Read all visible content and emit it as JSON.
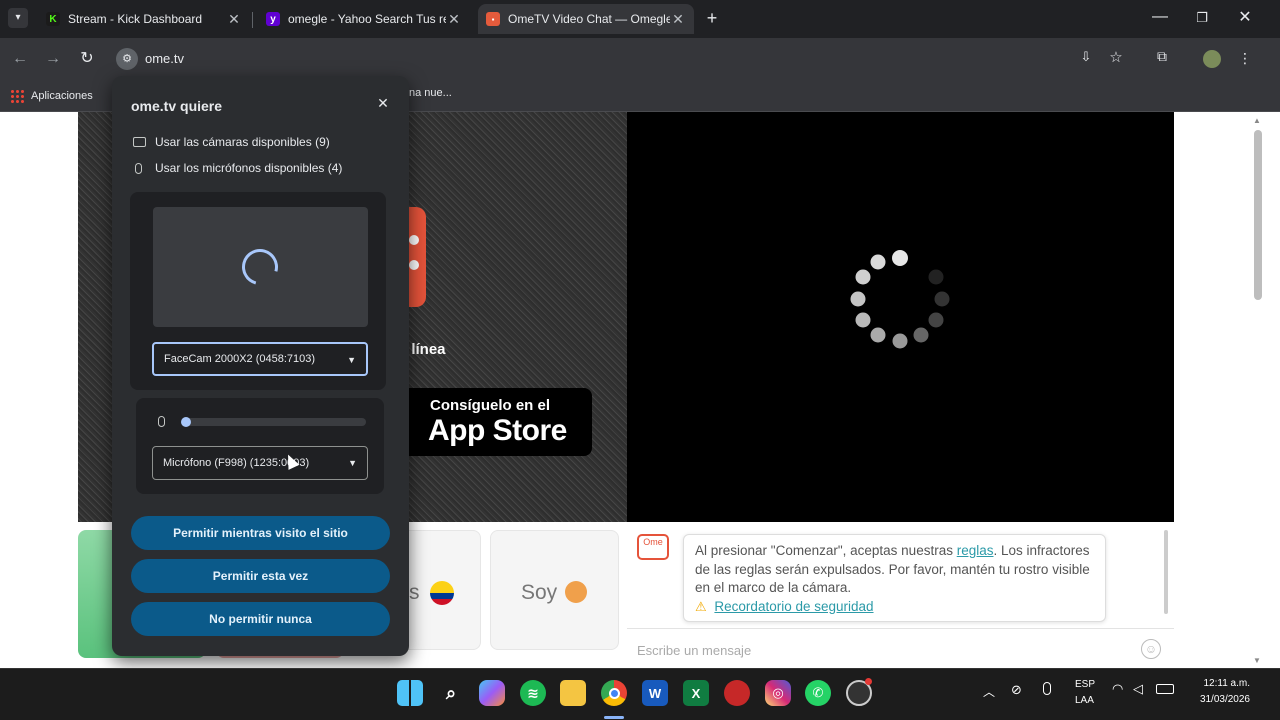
{
  "tabs": [
    {
      "title": "Stream - Kick Dashboard",
      "active": false
    },
    {
      "title": "omegle - Yahoo Search Tus resu",
      "active": false
    },
    {
      "title": "OmeTV Video Chat — Omegle",
      "active": true
    }
  ],
  "address": {
    "url": "ome.tv"
  },
  "bookmarks": {
    "apps_label": "Aplicaciones",
    "partial_item": "na nue..."
  },
  "permission_popup": {
    "title": "ome.tv quiere",
    "camera_request": "Usar las cámaras disponibles (9)",
    "mic_request": "Usar los micrófonos disponibles (4)",
    "camera_select": "FaceCam 2000X2 (0458:7103)",
    "mic_select": "Micrófono (F998) (1235:0003)",
    "mic_level": 0.0,
    "buttons": {
      "allow_while_visiting": "Permitir mientras visito el sitio",
      "allow_once": "Permitir esta vez",
      "never_allow": "No permitir nunca"
    }
  },
  "page": {
    "online_text_partial": "n línea",
    "app_store": {
      "line1": "Consíguelo en el",
      "line2": "App Store"
    },
    "soy_text": "Soy",
    "flag_partial_text": "s",
    "chat_notice": {
      "text_before": "Al presionar \"Comenzar\", aceptas nuestras ",
      "link": "reglas",
      "text_after": ". Los infractores de las reglas serán expulsados. Por favor, mantén tu rostro visible en el marco de la cámara.",
      "safety_link": "Recordatorio de seguridad"
    },
    "message_placeholder": "Escribe un mensaje",
    "logo_text": "Ome"
  },
  "taskbar": {
    "lang_top": "ESP",
    "lang_bottom": "LAA",
    "time": "12:11 a.m.",
    "date": "31/03/2026"
  },
  "colors": {
    "permit_button": "#0b5a8a",
    "chrome_dark": "#202124",
    "toolbar": "#35363a",
    "link": "#2b9aa8"
  }
}
